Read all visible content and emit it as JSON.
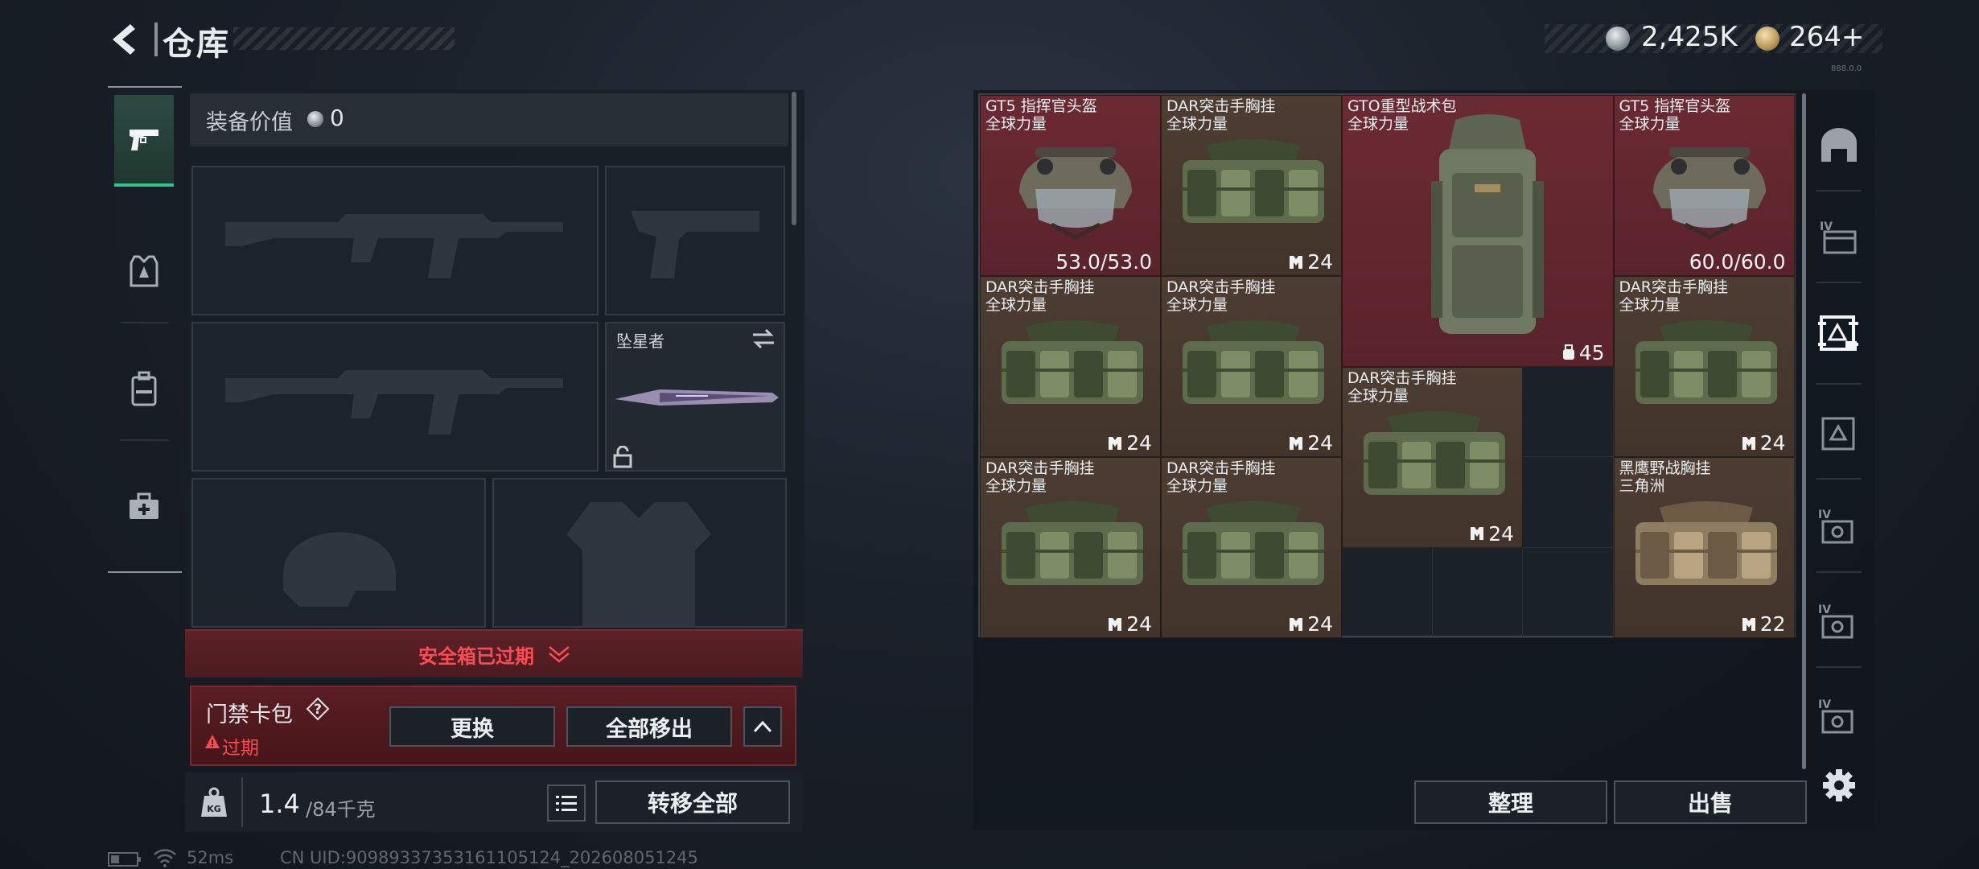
{
  "header": {
    "title": "仓库",
    "currency_silver": "2,425K",
    "currency_gold": "264+",
    "version_tag": "888.0.0"
  },
  "left_sidebar": {
    "items": [
      "pistol-category",
      "armor-category",
      "backpack-category",
      "medkit-category"
    ],
    "active": 0
  },
  "equipment": {
    "value_label": "装备价值",
    "value": "0",
    "melee_slot_name": "坠星者",
    "secure_case_status": "安全箱已过期",
    "card_pack_title": "门禁卡包",
    "card_pack_status": "过期",
    "swap_label": "更换",
    "move_all_label": "全部移出",
    "weight_current": "1.4",
    "weight_max": "/84千克",
    "transfer_all_label": "转移全部"
  },
  "storage": {
    "items": [
      {
        "name": "GT5 指挥官头盔",
        "sub": "全球力量",
        "count": "53.0/53.0",
        "kind": "helmet",
        "tone": "red"
      },
      {
        "name": "DAR突击手胸挂",
        "sub": "全球力量",
        "count": "24",
        "kind": "rig",
        "tone": "brown"
      },
      {
        "name": "GTO重型战术包",
        "sub": "全球力量",
        "count": "45",
        "kind": "backpack",
        "tone": "red"
      },
      {
        "name": "GT5 指挥官头盔",
        "sub": "全球力量",
        "count": "60.0/60.0",
        "kind": "helmet",
        "tone": "red"
      },
      {
        "name": "DAR突击手胸挂",
        "sub": "全球力量",
        "count": "24",
        "kind": "rig",
        "tone": "brown"
      },
      {
        "name": "DAR突击手胸挂",
        "sub": "全球力量",
        "count": "24",
        "kind": "rig",
        "tone": "brown"
      },
      {
        "name": "DAR突击手胸挂",
        "sub": "全球力量",
        "count": "24",
        "kind": "rig",
        "tone": "brown"
      },
      {
        "name": "DAR突击手胸挂",
        "sub": "全球力量",
        "count": "24",
        "kind": "rig",
        "tone": "brown"
      },
      {
        "name": "DAR突击手胸挂",
        "sub": "全球力量",
        "count": "24",
        "kind": "rig",
        "tone": "brown"
      },
      {
        "name": "DAR突击手胸挂",
        "sub": "全球力量",
        "count": "24",
        "kind": "rig",
        "tone": "brown"
      },
      {
        "name": "黑鹰野战胸挂",
        "sub": "三角洲",
        "count": "22",
        "kind": "rig-tan",
        "tone": "brown"
      }
    ],
    "sort_label": "整理",
    "sell_label": "出售"
  },
  "right_sidebar": {
    "items": [
      "home-tab",
      "storage-tab-iv-1",
      "storage-tab-active",
      "storage-tab-2",
      "storage-tab-iv-3",
      "storage-tab-iv-4",
      "storage-tab-iv-5",
      "settings"
    ]
  },
  "footer": {
    "ping": "52ms",
    "uid": "CN UID:9098933735316110512​4_202608051245"
  }
}
